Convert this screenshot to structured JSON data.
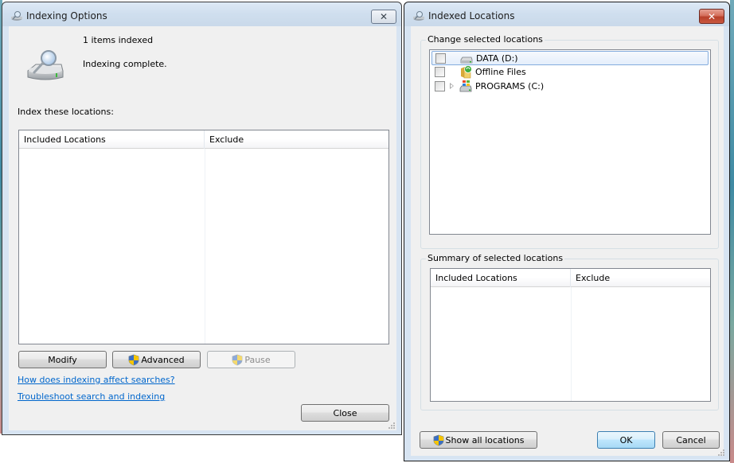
{
  "indexing_options": {
    "title": "Indexing Options",
    "status_count": "1 items indexed",
    "status_message": "Indexing complete.",
    "index_label": "Index these locations:",
    "table": {
      "columns": [
        "Included Locations",
        "Exclude"
      ],
      "rows": []
    },
    "buttons": {
      "modify": "Modify",
      "advanced": "Advanced",
      "pause": "Pause",
      "close": "Close"
    },
    "links": {
      "how_indexing": "How does indexing affect searches?",
      "troubleshoot": "Troubleshoot search and indexing"
    }
  },
  "indexed_locations": {
    "title": "Indexed Locations",
    "change_group_label": "Change selected locations",
    "tree": [
      {
        "label": "DATA (D:)",
        "icon": "hard-drive-icon",
        "checked": false,
        "selected": true,
        "expandable": false
      },
      {
        "label": "Offline Files",
        "icon": "offline-files-icon",
        "checked": false,
        "selected": false,
        "expandable": false
      },
      {
        "label": "PROGRAMS (C:)",
        "icon": "windows-drive-icon",
        "checked": false,
        "selected": false,
        "expandable": true
      }
    ],
    "summary_group_label": "Summary of selected locations",
    "summary_table": {
      "columns": [
        "Included Locations",
        "Exclude"
      ],
      "rows": []
    },
    "buttons": {
      "show_all": "Show all locations",
      "ok": "OK",
      "cancel": "Cancel"
    }
  }
}
